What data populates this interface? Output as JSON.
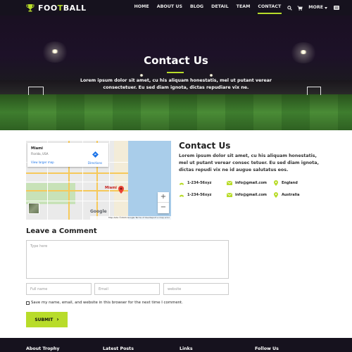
{
  "brand": {
    "name_prefix": "FOO",
    "name_accent": "T",
    "name_suffix": "BALL",
    "accent_color": "#b8dc2a",
    "dark_color": "#16121e"
  },
  "nav": {
    "items": [
      {
        "label": "HOME"
      },
      {
        "label": "ABOUT US"
      },
      {
        "label": "BLOG"
      },
      {
        "label": "DETAIL"
      },
      {
        "label": "TEAM"
      },
      {
        "label": "CONTACT",
        "active": true
      }
    ],
    "more_label": "MORE",
    "icons": [
      "search-icon",
      "cart-icon",
      "menu-icon"
    ]
  },
  "hero": {
    "title": "Contact Us",
    "text": "Lorem ipsum dolor sit amet, cu his aliquam honestatis, mel ut putant verear consectetuer. Eu sed diam ignota, dictas repudiare vix ne."
  },
  "map": {
    "place": "Miami",
    "region": "Florida, USA",
    "larger_map": "View larger map",
    "directions": "Directions",
    "city_label": "Miami",
    "attribution": "Map data ©2020 Google   Terms of Use   Report a map error",
    "google": "Google",
    "zoom_in": "+",
    "zoom_out": "−"
  },
  "contact": {
    "title": "Contact Us",
    "text": "Lorem ipsum dolor sit amet, cu his aliquam honestatis, mel ut putant verear consec tetuer. Eu sed diam ignota, dictas repudi vix ne id augue salutatus eos.",
    "rows": [
      {
        "phone": "1-234-56xyz",
        "email": "info@gmail.com",
        "location": "England"
      },
      {
        "phone": "1-234-56xyz",
        "email": "info@gmail.com",
        "location": "Australia"
      }
    ]
  },
  "comment": {
    "title": "Leave a Comment",
    "textarea_placeholder": "Type here",
    "name_placeholder": "Full name",
    "email_placeholder": "Email",
    "website_placeholder": "website",
    "save_label": "Save my name, email, and website in this browser for the next time I comment.",
    "submit_label": "SUBMIT"
  },
  "footer": {
    "headings": [
      "About Trophy",
      "Latest Posts",
      "Links",
      "Follow Us"
    ]
  }
}
